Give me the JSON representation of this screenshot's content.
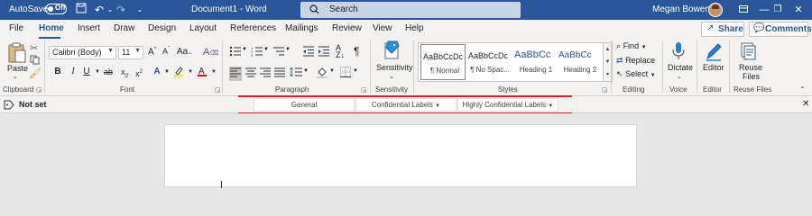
{
  "titlebar": {
    "autosave_label": "AutoSave",
    "autosave_state": "Off",
    "document_title": "Document1  -  Word",
    "search_placeholder": "Search",
    "user_name": "Megan Bowen"
  },
  "tabs": [
    "File",
    "Home",
    "Insert",
    "Draw",
    "Design",
    "Layout",
    "References",
    "Mailings",
    "Review",
    "View",
    "Help"
  ],
  "active_tab": "Home",
  "share_label": "Share",
  "comments_label": "Comments",
  "ribbon": {
    "clipboard": {
      "paste_label": "Paste",
      "group_label": "Clipboard"
    },
    "font": {
      "font_name": "Calibri (Body)",
      "font_size": "11",
      "group_label": "Font"
    },
    "paragraph": {
      "group_label": "Paragraph"
    },
    "sensitivity": {
      "button_label": "Sensitivity",
      "group_label": "Sensitivity"
    },
    "styles": {
      "group_label": "Styles",
      "items": [
        {
          "preview": "AaBbCcDc",
          "name": "¶ Normal"
        },
        {
          "preview": "AaBbCcDc",
          "name": "¶ No Spac..."
        },
        {
          "preview": "AaBbCc",
          "name": "Heading 1"
        },
        {
          "preview": "AaBbCc",
          "name": "Heading 2"
        }
      ]
    },
    "editing": {
      "find_label": "Find",
      "replace_label": "Replace",
      "select_label": "Select",
      "group_label": "Editing"
    },
    "voice": {
      "dictate_label": "Dictate",
      "group_label": "Voice"
    },
    "editor": {
      "editor_label": "Editor",
      "group_label": "Editor"
    },
    "reuse": {
      "reuse_label_1": "Reuse",
      "reuse_label_2": "Files",
      "group_label": "Reuse Files"
    }
  },
  "sensitivity_bar": {
    "status": "Not set",
    "labels": [
      "General",
      "Confidential Labels",
      "Highly Confidential Labels"
    ]
  },
  "colors": {
    "titlebar": "#2b579a",
    "accent": "#2b579a",
    "annotation_line": "#d21f1f",
    "ribbon_bg": "#f3f2f1"
  }
}
